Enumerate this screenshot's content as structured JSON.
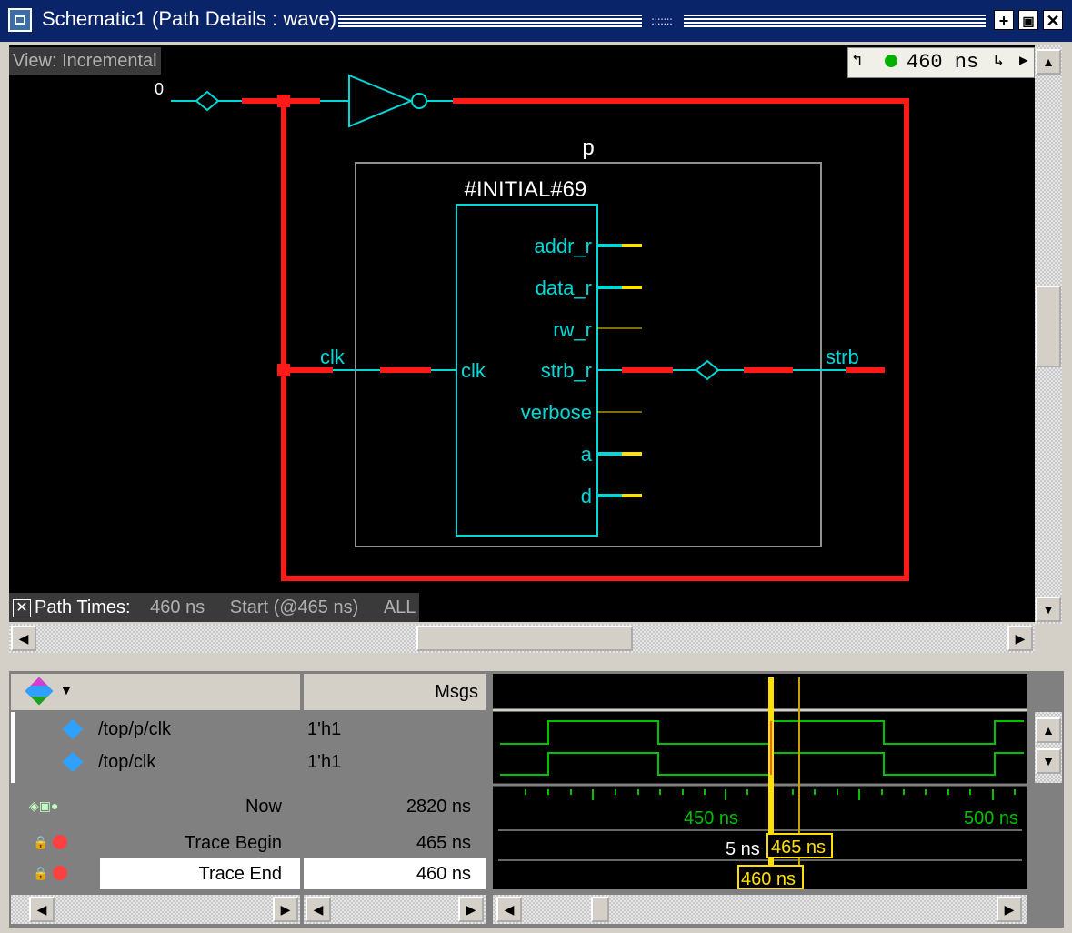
{
  "window": {
    "title": "Schematic1 (Path Details : wave)",
    "grip": ":::::::"
  },
  "schematic": {
    "view_label": "View: Incremental",
    "time_value": "460 ns",
    "input_value": "0",
    "instance_name": "p",
    "block_name": "#INITIAL#69",
    "left_port": "clk",
    "outer_left_label": "clk",
    "outer_right_label": "strb",
    "ports": [
      "addr_r",
      "data_r",
      "rw_r",
      "strb_r",
      "verbose",
      "a",
      "d"
    ]
  },
  "path_times": {
    "label": "Path Times:",
    "value": "460 ns",
    "start": "Start (@465 ns)",
    "filter": "ALL"
  },
  "wave": {
    "msgs_header": "Msgs",
    "signals": [
      {
        "name": "/top/p/clk",
        "value": "1'h1"
      },
      {
        "name": "/top/clk",
        "value": "1'h1"
      }
    ],
    "cursors": [
      {
        "label": "Now",
        "value": "2820 ns"
      },
      {
        "label": "Trace Begin",
        "value": "465 ns"
      },
      {
        "label": "Trace End",
        "value": "460 ns"
      }
    ],
    "ticks": [
      "450 ns",
      "500 ns"
    ],
    "delta": "5 ns",
    "cursor1_label": "465 ns",
    "cursor2_label": "460 ns"
  },
  "colors": {
    "net": "#ff1a1a",
    "pin": "#00d8d8",
    "bus": "#ffe000",
    "signal": "#00c000"
  }
}
